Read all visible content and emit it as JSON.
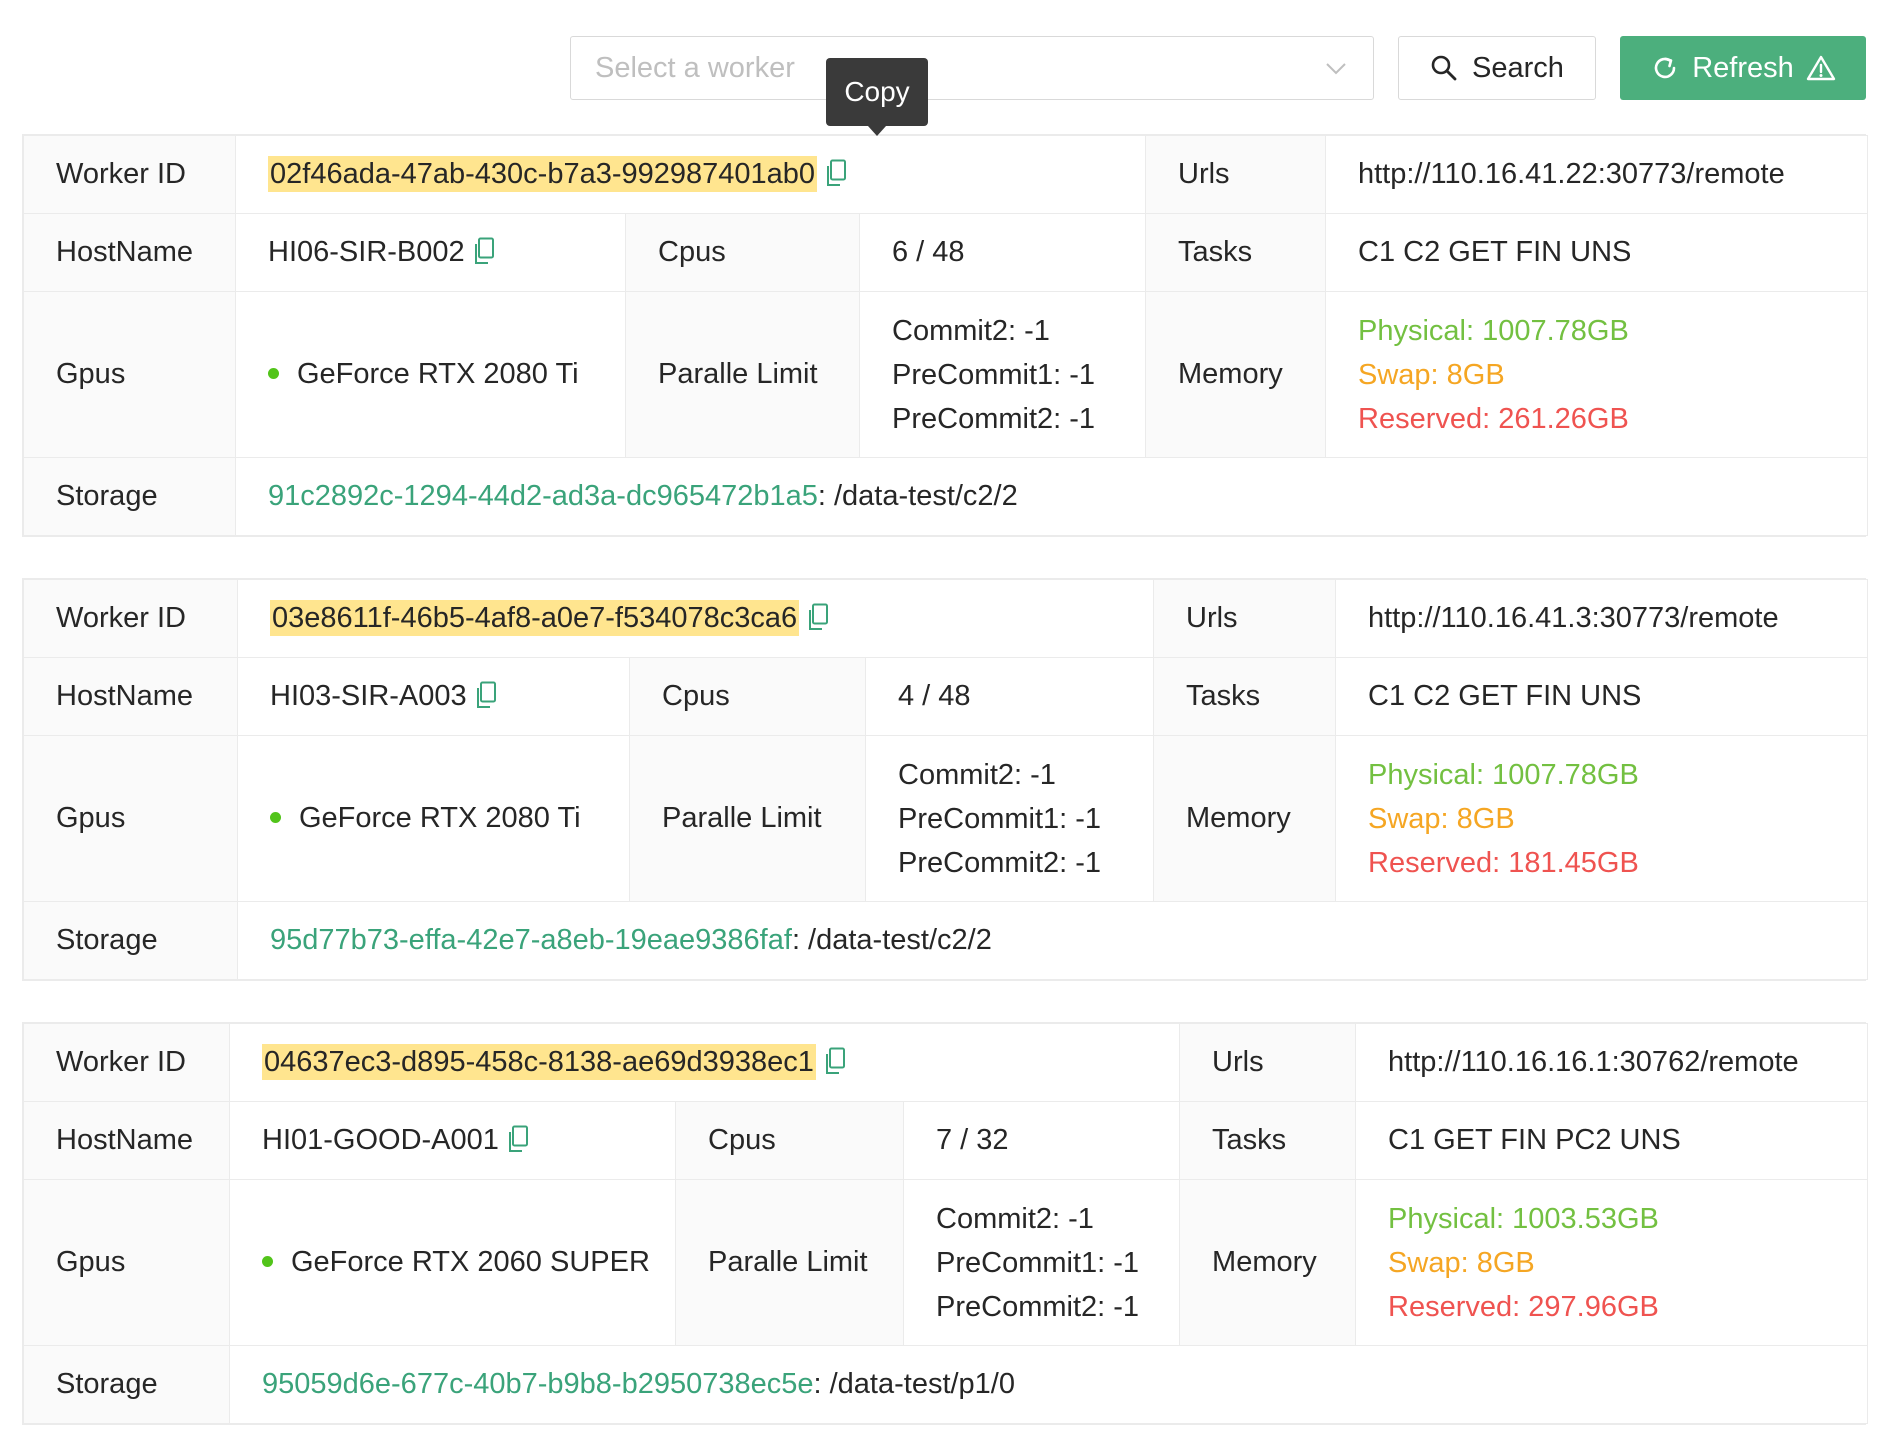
{
  "toolbar": {
    "select_placeholder": "Select a worker",
    "search_label": "Search",
    "refresh_label": "Refresh",
    "accent_color": "#4caf7d"
  },
  "tooltip": {
    "text": "Copy"
  },
  "labels": {
    "worker_id": "Worker ID",
    "urls": "Urls",
    "hostname": "HostName",
    "cpus": "Cpus",
    "tasks": "Tasks",
    "gpus": "Gpus",
    "paralle_limit": "Paralle Limit",
    "memory": "Memory",
    "storage": "Storage"
  },
  "workers": [
    {
      "worker_id": "02f46ada-47ab-430c-b7a3-992987401ab0",
      "url": "http://110.16.41.22:30773/remote",
      "hostname": "HI06-SIR-B002",
      "cpus": "6 / 48",
      "tasks": "C1 C2 GET FIN UNS",
      "gpu": "GeForce RTX 2080 Ti",
      "limits": [
        "Commit2: -1",
        "PreCommit1: -1",
        "PreCommit2: -1"
      ],
      "memory": {
        "physical": "Physical: 1007.78GB",
        "swap": "Swap: 8GB",
        "reserved": "Reserved: 261.26GB"
      },
      "storage_id": "91c2892c-1294-44d2-ad3a-dc965472b1a5",
      "storage_path": ": /data-test/c2/2"
    },
    {
      "worker_id": "03e8611f-46b5-4af8-a0e7-f534078c3ca6",
      "url": "http://110.16.41.3:30773/remote",
      "hostname": "HI03-SIR-A003",
      "cpus": "4 / 48",
      "tasks": "C1 C2 GET FIN UNS",
      "gpu": "GeForce RTX 2080 Ti",
      "limits": [
        "Commit2: -1",
        "PreCommit1: -1",
        "PreCommit2: -1"
      ],
      "memory": {
        "physical": "Physical: 1007.78GB",
        "swap": "Swap: 8GB",
        "reserved": "Reserved: 181.45GB"
      },
      "storage_id": "95d77b73-effa-42e7-a8eb-19eae9386faf",
      "storage_path": ": /data-test/c2/2"
    },
    {
      "worker_id": "04637ec3-d895-458c-8138-ae69d3938ec1",
      "url": "http://110.16.16.1:30762/remote",
      "hostname": "HI01-GOOD-A001",
      "cpus": "7 / 32",
      "tasks": "C1 GET FIN PC2 UNS",
      "gpu": "GeForce RTX 2060 SUPER",
      "limits": [
        "Commit2: -1",
        "PreCommit1: -1",
        "PreCommit2: -1"
      ],
      "memory": {
        "physical": "Physical: 1003.53GB",
        "swap": "Swap: 8GB",
        "reserved": "Reserved: 297.96GB"
      },
      "storage_id": "95059d6e-677c-40b7-b9b8-b2950738ec5e",
      "storage_path": ": /data-test/p1/0"
    }
  ]
}
